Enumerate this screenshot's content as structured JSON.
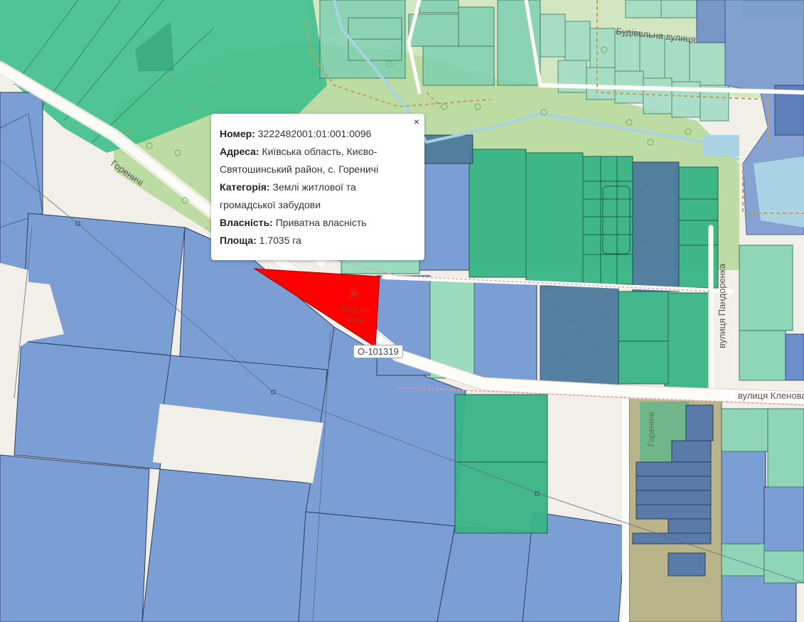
{
  "map": {
    "streets": {
      "budivelna": "Будівельна вулиця",
      "horenychi_road": "Гореничі",
      "pandorenka": "вулиця Пандоренка",
      "klenova": "вулиця Кленова",
      "horenychi_small": "Гореничі"
    },
    "route_shield": "O-101319",
    "poi_label": "Вид на Київ",
    "highlight_color": "#ff0000"
  },
  "popup": {
    "number_label": "Номер:",
    "number_value": "3222482001:01:001:0096",
    "address_label": "Адреса:",
    "address_value": "Київська область, Києво-Святошинський район, с. Гореничі",
    "category_label": "Категорія:",
    "category_value": "Землі житлової та громадської забудови",
    "ownership_label": "Власність:",
    "ownership_value": "Приватна власність",
    "area_label": "Площа:",
    "area_value": "1.7035 га",
    "close_label": "×"
  }
}
